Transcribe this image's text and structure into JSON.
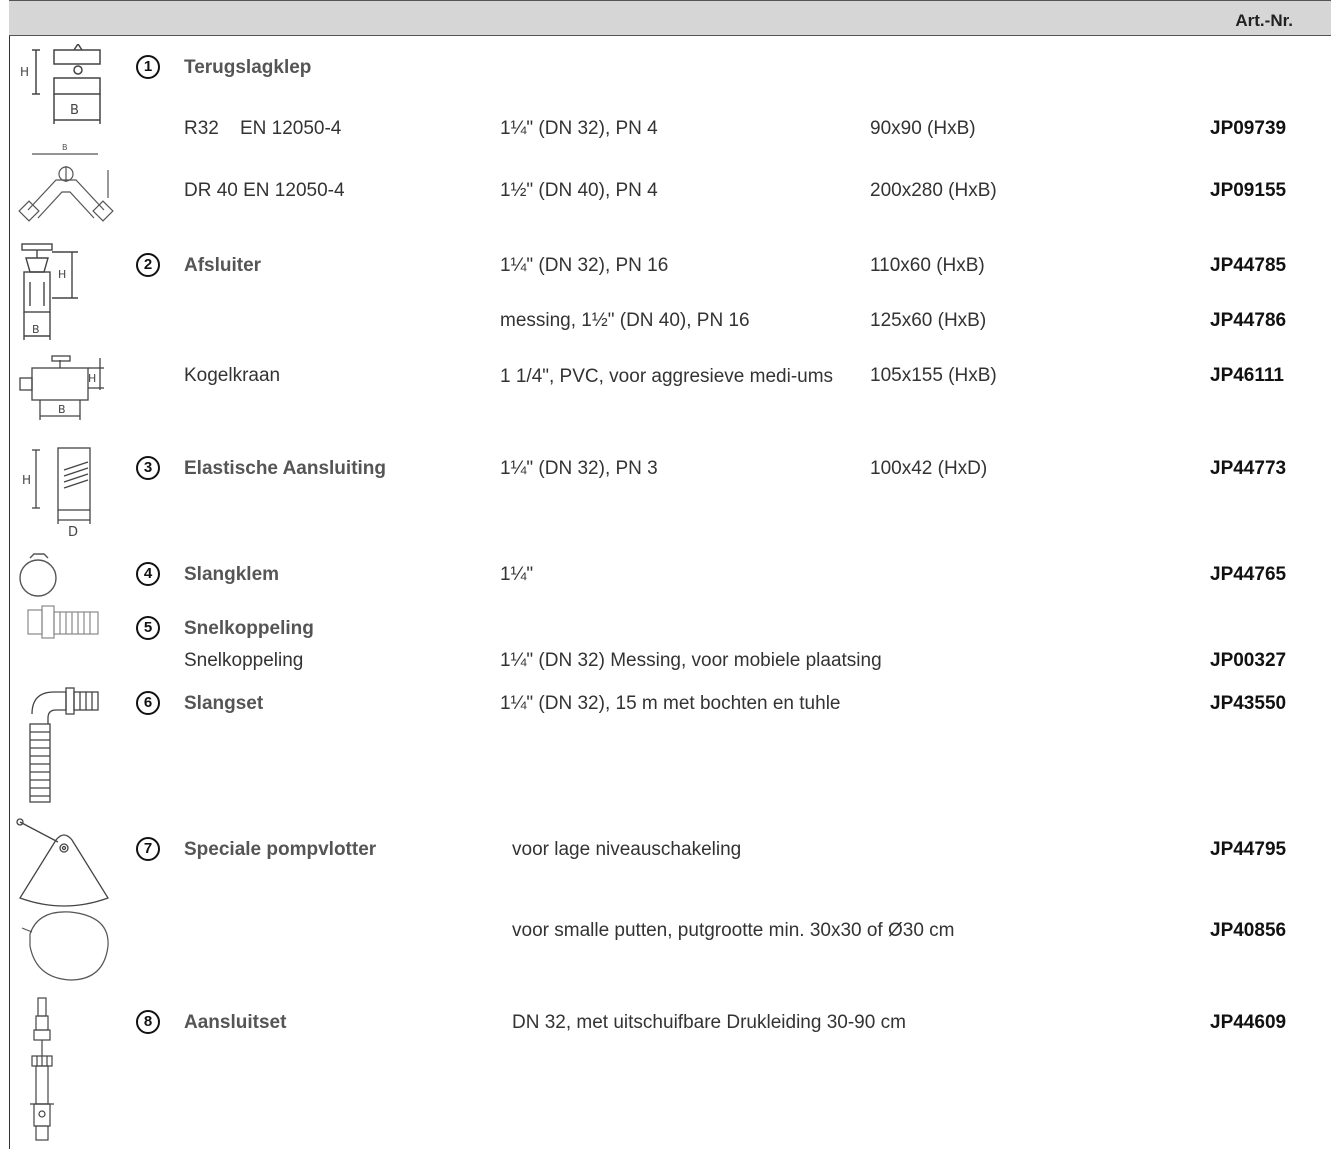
{
  "header": {
    "art_label": "Art.-Nr."
  },
  "products": [
    {
      "num": "1",
      "title": "Terugslagklep",
      "icon": "check-valve-diagram-icon"
    },
    {
      "name": "R32    EN 12050-4",
      "spec": "1¼\" (DN 32), PN 4",
      "dims": "90x90 (HxB)",
      "art": "JP09739"
    },
    {
      "name": "DR 40 EN 12050-4",
      "spec": "1½\" (DN 40), PN 4",
      "dims": "200x280 (HxB)",
      "art": "JP09155",
      "icon": "y-check-valve-diagram-icon"
    },
    {
      "num": "2",
      "title": "Afsluiter",
      "spec": "1¼\" (DN 32), PN 16",
      "dims": "110x60 (HxB)",
      "art": "JP44785",
      "icon": "gate-valve-diagram-icon"
    },
    {
      "spec": "messing, 1½\" (DN 40), PN 16",
      "dims": "125x60 (HxB)",
      "art": "JP44786"
    },
    {
      "name": "Kogelkraan",
      "spec": "1 1/4\", PVC, voor aggresieve medi-ums",
      "dims": "105x155 (HxB)",
      "art": "JP46111",
      "icon": "ball-valve-diagram-icon"
    },
    {
      "num": "3",
      "title": "Elastische Aansluiting",
      "spec": "1¼\" (DN 32), PN 3",
      "dims": "100x42 (HxD)",
      "art": "JP44773",
      "icon": "elastic-connector-diagram-icon"
    },
    {
      "num": "4",
      "title": "Slangklem",
      "spec": "1¼\"",
      "art": "JP44765",
      "icon": "hose-clamp-icon"
    },
    {
      "num": "5",
      "title": "Snelkoppeling",
      "name2": "Snelkoppeling",
      "spec": "1¼\" (DN 32) Messing, voor mobiele plaatsing",
      "art": "JP00327",
      "icon": "quick-coupling-icon"
    },
    {
      "num": "6",
      "title": "Slangset",
      "spec": "1¼\" (DN 32), 15 m met bochten en tuhle",
      "art": "JP43550",
      "icon": "hose-set-icon"
    },
    {
      "num": "7",
      "title": "Speciale pompvlotter",
      "spec": "voor lage niveauschakeling",
      "art": "JP44795",
      "icon": "pump-float-icon"
    },
    {
      "spec": "voor smalle putten, putgrootte min. 30x30 of Ø30 cm",
      "art": "JP40856",
      "icon": "round-float-icon"
    },
    {
      "num": "8",
      "title": "Aansluitset",
      "spec": "DN 32, met uitschuifbare Drukleiding 30-90 cm",
      "art": "JP44609",
      "icon": "connection-set-icon"
    }
  ]
}
